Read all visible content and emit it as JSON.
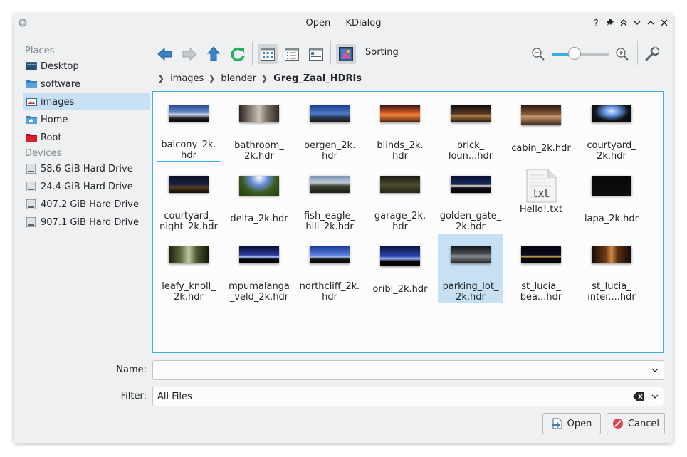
{
  "window": {
    "title": "Open — KDialog",
    "buttons": [
      "help-icon",
      "pin-icon",
      "keep-above-icon",
      "minimize-icon",
      "maximize-icon",
      "close-icon"
    ]
  },
  "sidebar": {
    "places_title": "Places",
    "places": [
      {
        "label": "Desktop",
        "icon": "desktop-folder-icon"
      },
      {
        "label": "software",
        "icon": "folder-icon"
      },
      {
        "label": "images",
        "icon": "pictures-folder-icon",
        "selected": true
      },
      {
        "label": "Home",
        "icon": "home-folder-icon"
      },
      {
        "label": "Root",
        "icon": "root-folder-icon"
      }
    ],
    "devices_title": "Devices",
    "devices": [
      {
        "label": "58.6 GiB Hard Drive",
        "icon": "hard-drive-icon"
      },
      {
        "label": "24.4 GiB Hard Drive",
        "icon": "hard-drive-icon"
      },
      {
        "label": "407.2 GiB Hard Drive",
        "icon": "hard-drive-icon"
      },
      {
        "label": "907.1 GiB Hard Drive",
        "icon": "hard-drive-icon"
      }
    ]
  },
  "toolbar": {
    "sorting_label": "Sorting",
    "zoom_level": 0.4,
    "accent": "#3daee9"
  },
  "breadcrumb": {
    "items": [
      "images",
      "blender",
      "Greg_Zaal_HDRIs"
    ]
  },
  "files": [
    {
      "name": "balcony_2k.\nhdr"
    },
    {
      "name": "bathroom_\n2k.hdr"
    },
    {
      "name": "bergen_2k.\nhdr"
    },
    {
      "name": "blinds_2k.\nhdr"
    },
    {
      "name": "brick_\nloun...hdr"
    },
    {
      "name": "cabin_2k.hdr"
    },
    {
      "name": "courtyard_\n2k.hdr"
    },
    {
      "name": "courtyard_\nnight_2k.hdr"
    },
    {
      "name": "delta_2k.hdr"
    },
    {
      "name": "fish_eagle_\nhill_2k.hdr"
    },
    {
      "name": "garage_2k.\nhdr"
    },
    {
      "name": "golden_gate_\n2k.hdr"
    },
    {
      "name": "Hello!.txt",
      "icon_text": "txt"
    },
    {
      "name": "lapa_2k.hdr"
    },
    {
      "name": "leafy_knoll_\n2k.hdr"
    },
    {
      "name": "mpumalanga\n_veld_2k.hdr"
    },
    {
      "name": "northcliff_2k.\nhdr"
    },
    {
      "name": "oribi_2k.hdr"
    },
    {
      "name": "parking_lot_\n2k.hdr",
      "selected": true
    },
    {
      "name": "st_lucia_\nbea...hdr"
    },
    {
      "name": "st_lucia_\ninter....hdr"
    }
  ],
  "form": {
    "name_label": "Name:",
    "name_value": "",
    "filter_label": "Filter:",
    "filter_value": "All Files"
  },
  "buttons": {
    "open": "Open",
    "cancel": "Cancel"
  }
}
